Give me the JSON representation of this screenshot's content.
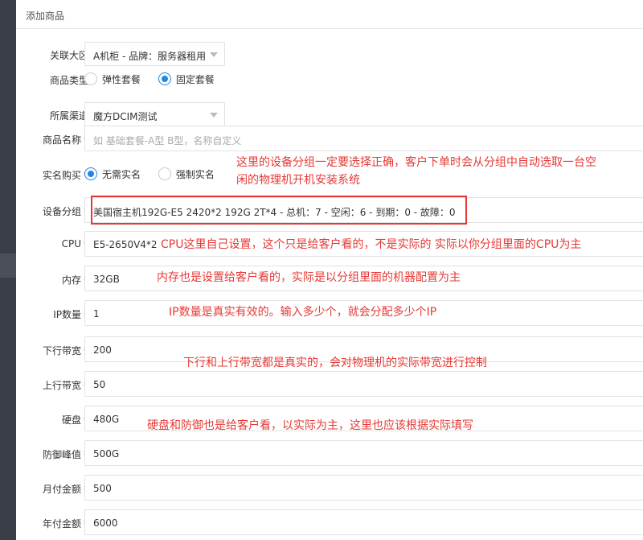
{
  "header": {
    "title": "添加商品"
  },
  "fields": {
    "region": {
      "label": "关联大区",
      "value": "A机柜 - 品牌：服务器租用"
    },
    "product_type": {
      "label": "商品类型",
      "options": [
        "弹性套餐",
        "固定套餐"
      ],
      "selected": "固定套餐"
    },
    "channel": {
      "label": "所属渠道",
      "value": "魔方DCIM测试"
    },
    "product_name": {
      "label": "商品名称",
      "required": "*",
      "placeholder": "如 基础套餐-A型  B型，名称自定义"
    },
    "realname": {
      "label": "实名购买",
      "required": "*",
      "options": [
        "无需实名",
        "强制实名"
      ],
      "selected": "无需实名"
    },
    "device_group": {
      "label": "设备分组",
      "required": "*",
      "value": "美国宿主机192G-E5 2420*2  192G  2T*4 - 总机：7 - 空闲：6 - 到期：0 - 故障：0"
    },
    "cpu": {
      "label": "CPU",
      "required": "*",
      "value": "E5-2650V4*2"
    },
    "memory": {
      "label": "内存",
      "required": "*",
      "value": "32GB"
    },
    "ip_count": {
      "label": "IP数量",
      "required": "*",
      "value": "1"
    },
    "downlink": {
      "label": "下行带宽",
      "required": "*",
      "value": "200"
    },
    "uplink": {
      "label": "上行带宽",
      "required": "*",
      "value": "50"
    },
    "disk": {
      "label": "硬盘",
      "required": "*",
      "value": "480G"
    },
    "defense": {
      "label": "防御峰值",
      "required": "*",
      "value": "500G"
    },
    "monthly": {
      "label": "月付金额",
      "required": "*",
      "value": "500"
    },
    "yearly": {
      "label": "年付金额",
      "required": "*",
      "value": "6000"
    }
  },
  "annotations": {
    "device_group_line1": "这里的设备分组一定要选择正确，客户下单时会从分组中自动选取一台空",
    "device_group_line2": "闲的物理机开机安装系统",
    "cpu": "CPU这里自己设置，这个只是给客户看的，不是实际的 实际以你分组里面的CPU为主",
    "memory": "内存也是设置给客户看的，实际是以分组里面的机器配置为主",
    "ip": "IP数量是真实有效的。输入多少个，就会分配多少个IP",
    "bandwidth": "下行和上行带宽都是真实的，会对物理机的实际带宽进行控制",
    "disk": "硬盘和防御也是给客户看，以实际为主，这里也应该根据实际填写"
  },
  "colors": {
    "accent": "#1e88e5",
    "annotation": "#e53935",
    "required": "#e4393c"
  }
}
